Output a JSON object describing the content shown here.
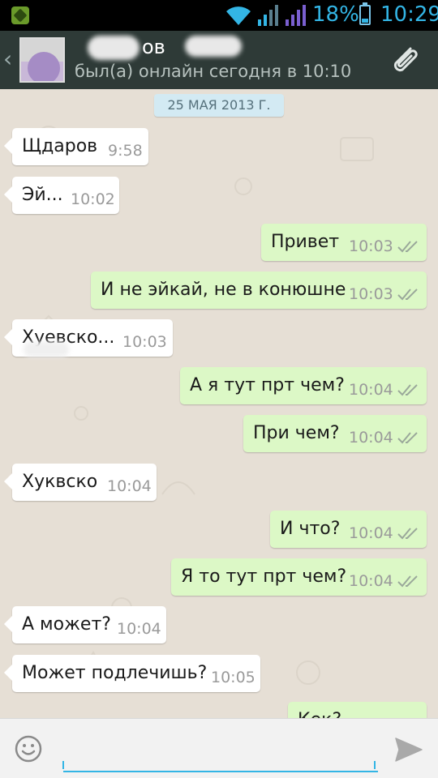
{
  "status_bar": {
    "battery_percent": "18%",
    "time": "10:29"
  },
  "header": {
    "contact_name": "ов",
    "last_seen": "был(а) онлайн сегодня в 10:10"
  },
  "chat": {
    "date_separator": "25 МАЯ 2013 Г.",
    "messages": [
      {
        "dir": "in",
        "text": "Щдаров",
        "time": "9:58"
      },
      {
        "dir": "in",
        "text": "Эй...",
        "time": "10:02"
      },
      {
        "dir": "out",
        "text": "Привет",
        "time": "10:03"
      },
      {
        "dir": "out",
        "text": "И не эйкай, не в конюшне",
        "time": "10:03"
      },
      {
        "dir": "in",
        "text": "Хуевско...",
        "time": "10:03"
      },
      {
        "dir": "out",
        "text": "А я тут прт чем?",
        "time": "10:04"
      },
      {
        "dir": "out",
        "text": "При чем?",
        "time": "10:04"
      },
      {
        "dir": "in",
        "text": "Хуквско",
        "time": "10:04"
      },
      {
        "dir": "out",
        "text": "И что?",
        "time": "10:04"
      },
      {
        "dir": "out",
        "text": "Я то тут прт чем?",
        "time": "10:04"
      },
      {
        "dir": "in",
        "text": "А может?",
        "time": "10:04"
      },
      {
        "dir": "in",
        "text": "Может подлечишь?",
        "time": "10:05"
      },
      {
        "dir": "out",
        "text": "Кек?",
        "time": ""
      }
    ]
  },
  "input": {
    "value": "",
    "placeholder": ""
  },
  "icons": {
    "back": "chevron-left-icon",
    "attach": "paperclip-icon",
    "emoji": "smiley-icon",
    "send": "send-icon",
    "read": "double-check-icon"
  },
  "colors": {
    "header_bg": "#2e3a37",
    "outgoing_bubble": "#dcf8c6",
    "incoming_bubble": "#ffffff",
    "accent": "#33b5e5"
  }
}
